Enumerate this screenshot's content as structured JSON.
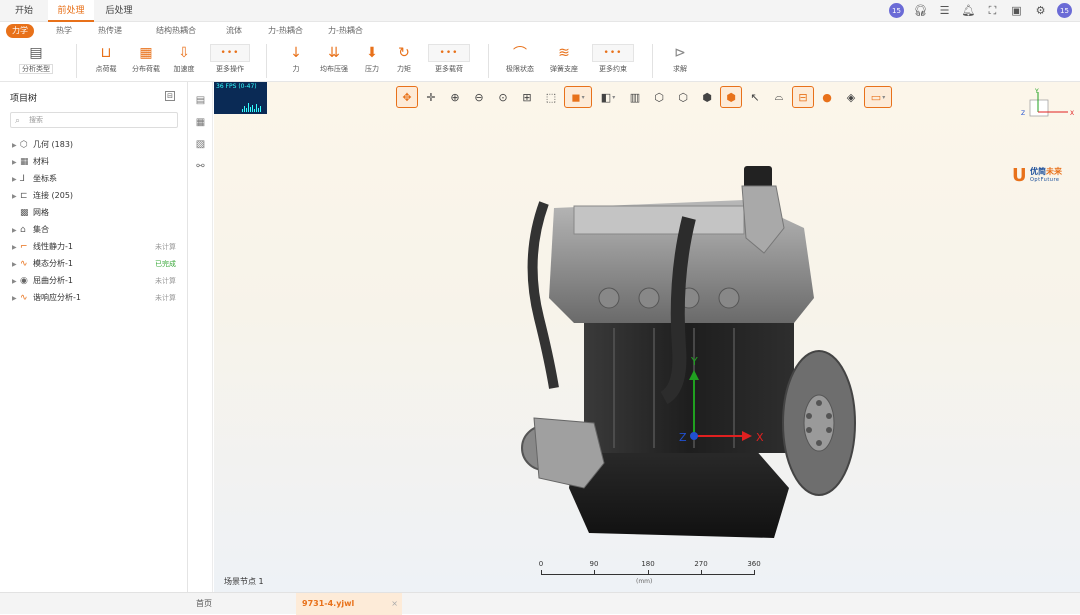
{
  "menu_tabs": [
    {
      "label": "开始"
    },
    {
      "label": "前处理"
    },
    {
      "label": "后处理"
    }
  ],
  "sub_tabs": [
    {
      "label": "力学"
    },
    {
      "label": "热学"
    },
    {
      "label": "热传递"
    },
    {
      "label": "结构热耦合"
    },
    {
      "label": "流体"
    },
    {
      "label": "力-热耦合"
    },
    {
      "label": "力-热耦合"
    }
  ],
  "ribbon": {
    "analysis_type": "分析类型",
    "buttons": [
      {
        "label": "点荷载",
        "icon": "fixed-support-icon"
      },
      {
        "label": "分布荷载",
        "icon": "distributed-load-icon"
      },
      {
        "label": "加速度",
        "icon": "acceleration-icon"
      },
      {
        "label": "更多操作",
        "icon": "more-icon"
      },
      {
        "label": "力",
        "icon": "force-icon"
      },
      {
        "label": "均布压强",
        "icon": "pressure-icon"
      },
      {
        "label": "压力",
        "icon": "pressure-down-icon"
      },
      {
        "label": "力矩",
        "icon": "moment-icon"
      },
      {
        "label": "更多载荷",
        "icon": "more-icon"
      },
      {
        "label": "极限状态",
        "icon": "limit-icon"
      },
      {
        "label": "弹簧支座",
        "icon": "spring-icon"
      },
      {
        "label": "更多约束",
        "icon": "more-icon"
      },
      {
        "label": "求解",
        "icon": "solve-icon"
      }
    ]
  },
  "project_tree": {
    "title": "项目树",
    "search_placeholder": "搜索",
    "items": [
      {
        "label": "几何 (183)",
        "icon": "cube-icon",
        "status": ""
      },
      {
        "label": "材料",
        "icon": "material-icon",
        "status": ""
      },
      {
        "label": "坐标系",
        "icon": "axis-icon",
        "status": ""
      },
      {
        "label": "连接 (205)",
        "icon": "connection-icon",
        "status": ""
      },
      {
        "label": "网格",
        "icon": "mesh-icon",
        "status": ""
      },
      {
        "label": "集合",
        "icon": "set-icon",
        "status": ""
      },
      {
        "label": "线性静力-1",
        "icon": "static-icon",
        "status": "未计算"
      },
      {
        "label": "模态分析-1",
        "icon": "modal-icon",
        "status": "已完成"
      },
      {
        "label": "屈曲分析-1",
        "icon": "buckling-icon",
        "status": "未计算"
      },
      {
        "label": "谐响应分析-1",
        "icon": "harmonic-icon",
        "status": "未计算"
      }
    ]
  },
  "viewport": {
    "fps_text": "36 FPS (0-47)",
    "scene_label": "场景节点 1",
    "axis_labels": {
      "x": "X",
      "y": "Y",
      "z": "Z"
    },
    "logo_main": "优简",
    "logo_accent": "未来",
    "logo_sub": "OptFuture",
    "scale": {
      "ticks": [
        "0",
        "90",
        "180",
        "270",
        "360"
      ],
      "unit": "(mm)"
    }
  },
  "bottom_tabs": [
    {
      "label": "首页"
    },
    {
      "label": "9731-4.yjwl"
    }
  ],
  "colors": {
    "accent": "#e8711a",
    "axis_x": "#e02020",
    "axis_y": "#20a020",
    "axis_z": "#2050d0"
  }
}
